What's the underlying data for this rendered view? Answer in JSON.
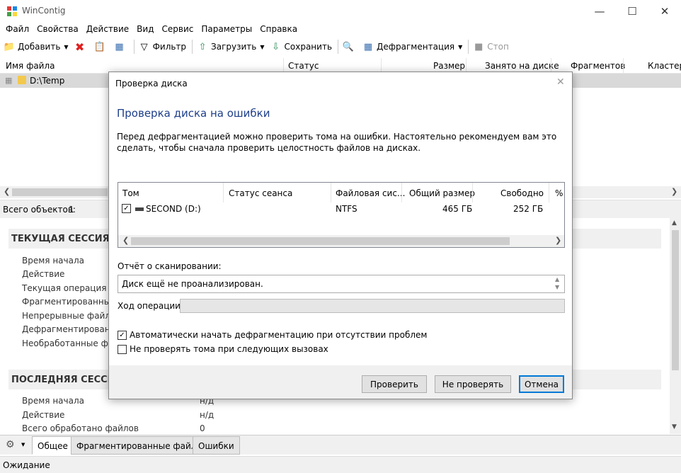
{
  "window": {
    "title": "WinContig"
  },
  "menu": [
    "Файл",
    "Свойства",
    "Действие",
    "Вид",
    "Сервис",
    "Параметры",
    "Справка"
  ],
  "toolbar": {
    "add_label": "Добавить",
    "filter_label": "Фильтр",
    "load_label": "Загрузить",
    "save_label": "Сохранить",
    "defrag_label": "Дефрагментация",
    "stop_label": "Стоп"
  },
  "list": {
    "columns": [
      "Имя файла",
      "Статус",
      "Размер",
      "Занято на диске",
      "Фрагментов",
      "Кластер"
    ],
    "rows": [
      {
        "name": "D:\\Temp"
      }
    ]
  },
  "status": {
    "total_label": "Всего объектов:",
    "total_value": "1"
  },
  "sessions": {
    "current": {
      "heading": "ТЕКУЩАЯ СЕССИЯ",
      "props": [
        "Время начала",
        "Действие",
        "Текущая операция",
        "Фрагментированные ф",
        "Непрерывные файлы",
        "Дефрагментированн",
        "Необработанные фай"
      ]
    },
    "last": {
      "heading": "ПОСЛЕДНЯЯ СЕССИЯ",
      "props": [
        {
          "label": "Время начала",
          "value": "н/д"
        },
        {
          "label": "Действие",
          "value": "н/д"
        },
        {
          "label": "Всего обработано файлов",
          "value": "0"
        }
      ]
    }
  },
  "tabs": [
    "Общее",
    "Фрагментированные файлы",
    "Ошибки"
  ],
  "footer": {
    "status": "Ожидание"
  },
  "dialog": {
    "title": "Проверка диска",
    "heading": "Проверка диска на ошибки",
    "description": "Перед дефрагментацией можно проверить тома на ошибки. Настоятельно рекомендуем вам это сделать, чтобы сначала проверить целостность файлов на дисках.",
    "volumes": {
      "columns": [
        "Том",
        "Статус сеанса",
        "Файловая сис...",
        "Общий размер",
        "Свободно",
        "%"
      ],
      "rows": [
        {
          "checked": true,
          "name": "SECOND (D:)",
          "status": "",
          "fs": "NTFS",
          "total": "465 ГБ",
          "free": "252 ГБ"
        }
      ]
    },
    "report_label": "Отчёт о сканировании:",
    "report_value": "Диск ещё не проанализирован.",
    "progress_label": "Ход операции:",
    "progress_value": 0,
    "option_auto": "Автоматически начать дефрагментацию при отсутствии проблем",
    "option_auto_checked": true,
    "option_skip": "Не проверять тома при следующих вызовах",
    "option_skip_checked": false,
    "btn_check": "Проверить",
    "btn_skip": "Не проверять",
    "btn_cancel": "Отмена"
  },
  "colors": {
    "accent": "#0078d7",
    "heading": "#1e3f8a"
  }
}
